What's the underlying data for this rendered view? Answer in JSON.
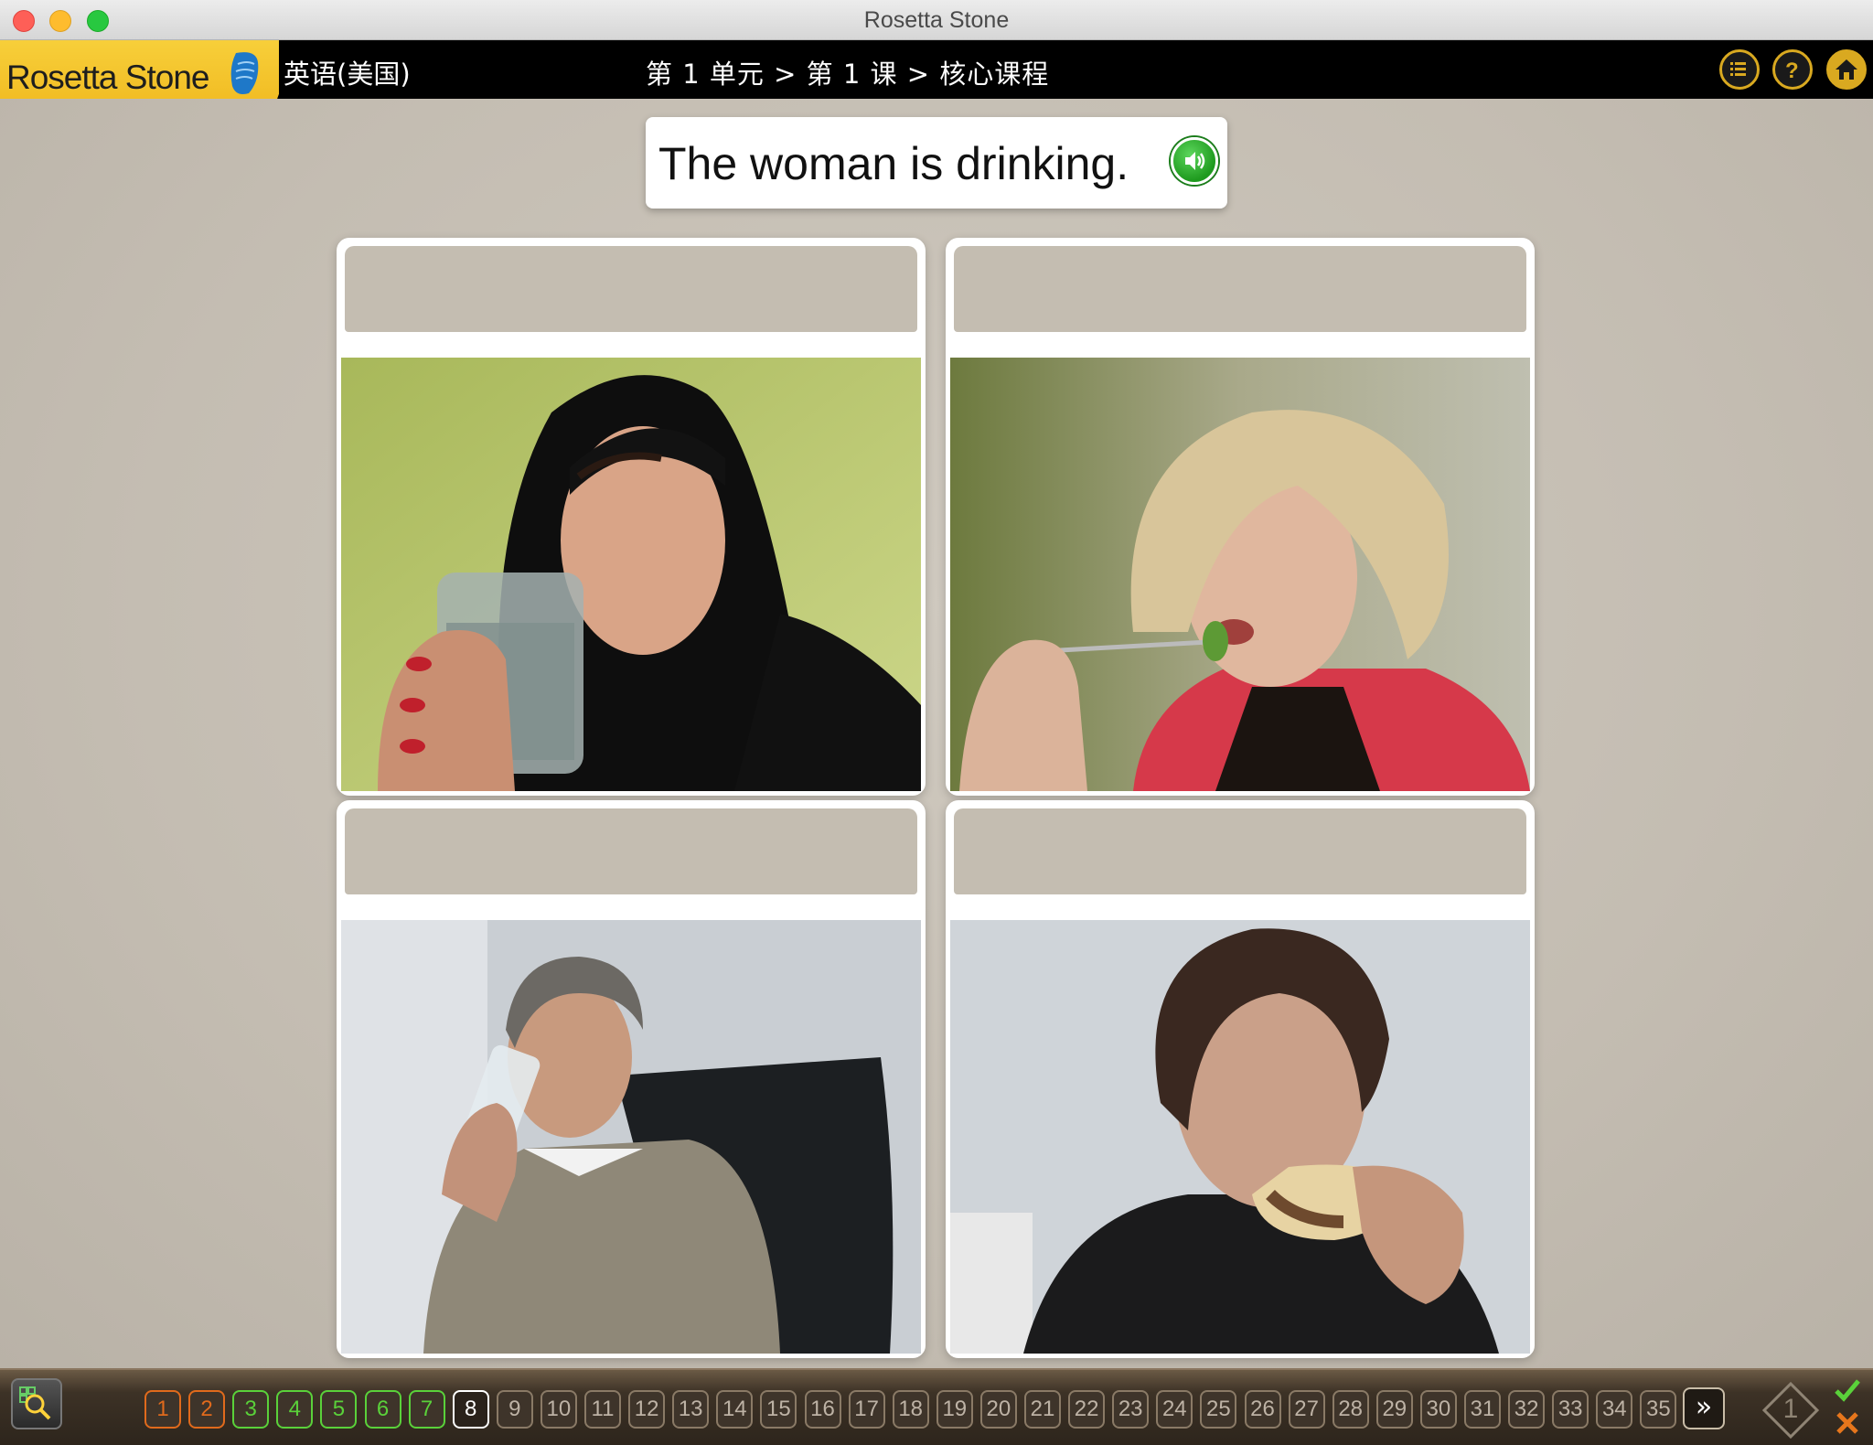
{
  "window": {
    "title": "Rosetta Stone"
  },
  "header": {
    "logo_text": "Rosetta Stone",
    "language": "英语(美国)",
    "breadcrumb": "第 1 单元 > 第 1 课 > 核心课程",
    "icons": [
      "menu-list-icon",
      "help-icon",
      "home-icon"
    ]
  },
  "prompt": {
    "text": "The woman is drinking.",
    "audio_icon": "speaker-icon",
    "audio_color": "#2aa52a"
  },
  "cards": [
    {
      "label": "",
      "image": "woman in hijab drinking water"
    },
    {
      "label": "",
      "image": "blonde woman eating with fork"
    },
    {
      "label": "",
      "image": "older man drinking water"
    },
    {
      "label": "",
      "image": "man eating sandwich"
    }
  ],
  "footer": {
    "pages": [
      "1",
      "2",
      "3",
      "4",
      "5",
      "6",
      "7",
      "8",
      "9",
      "10",
      "11",
      "12",
      "13",
      "14",
      "15",
      "16",
      "17",
      "18",
      "19",
      "20",
      "21",
      "22",
      "23",
      "24",
      "25",
      "26",
      "27",
      "28",
      "29",
      "30",
      "31",
      "32",
      "33",
      "34",
      "35"
    ],
    "current_page": "8",
    "next_label": "»",
    "attempt_label": "1",
    "colors": {
      "orange": "#e06a1c",
      "green": "#5ad13a"
    }
  }
}
